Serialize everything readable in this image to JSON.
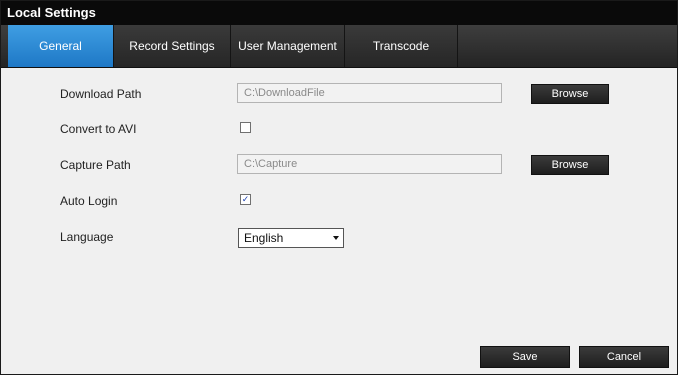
{
  "window": {
    "title": "Local Settings"
  },
  "tabs": [
    {
      "label": "General",
      "active": true
    },
    {
      "label": "Record Settings",
      "active": false
    },
    {
      "label": "User Management",
      "active": false
    },
    {
      "label": "Transcode",
      "active": false
    }
  ],
  "form": {
    "download_path": {
      "label": "Download Path",
      "value": "C:\\DownloadFile",
      "browse_label": "Browse"
    },
    "convert_avi": {
      "label": "Convert to AVI",
      "checked": false
    },
    "capture_path": {
      "label": "Capture Path",
      "value": "C:\\Capture",
      "browse_label": "Browse"
    },
    "auto_login": {
      "label": "Auto Login",
      "checked": true
    },
    "language": {
      "label": "Language",
      "selected": "English"
    }
  },
  "footer": {
    "save_label": "Save",
    "cancel_label": "Cancel"
  },
  "colors": {
    "active_tab": "#2b8ad6",
    "tab_bar": "#2f2f2f",
    "title_bar": "#0a0a0a",
    "button": "#2a2a2a"
  },
  "icons": {
    "checkbox_checked": "checkmark-icon",
    "dropdown": "chevron-down-icon"
  }
}
